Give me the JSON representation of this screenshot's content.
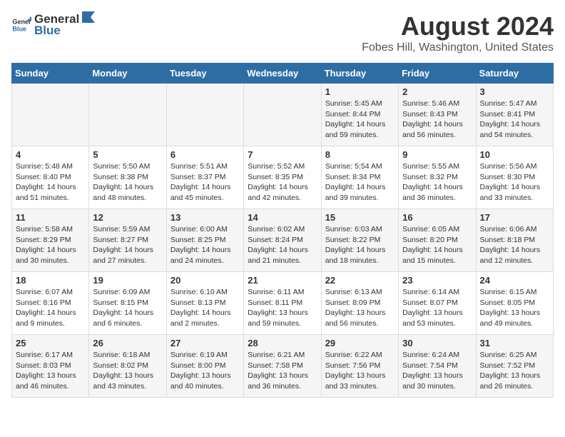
{
  "header": {
    "logo_general": "General",
    "logo_blue": "Blue",
    "title": "August 2024",
    "subtitle": "Fobes Hill, Washington, United States"
  },
  "weekdays": [
    "Sunday",
    "Monday",
    "Tuesday",
    "Wednesday",
    "Thursday",
    "Friday",
    "Saturday"
  ],
  "weeks": [
    [
      {
        "day": "",
        "info": ""
      },
      {
        "day": "",
        "info": ""
      },
      {
        "day": "",
        "info": ""
      },
      {
        "day": "",
        "info": ""
      },
      {
        "day": "1",
        "info": "Sunrise: 5:45 AM\nSunset: 8:44 PM\nDaylight: 14 hours\nand 59 minutes."
      },
      {
        "day": "2",
        "info": "Sunrise: 5:46 AM\nSunset: 8:43 PM\nDaylight: 14 hours\nand 56 minutes."
      },
      {
        "day": "3",
        "info": "Sunrise: 5:47 AM\nSunset: 8:41 PM\nDaylight: 14 hours\nand 54 minutes."
      }
    ],
    [
      {
        "day": "4",
        "info": "Sunrise: 5:48 AM\nSunset: 8:40 PM\nDaylight: 14 hours\nand 51 minutes."
      },
      {
        "day": "5",
        "info": "Sunrise: 5:50 AM\nSunset: 8:38 PM\nDaylight: 14 hours\nand 48 minutes."
      },
      {
        "day": "6",
        "info": "Sunrise: 5:51 AM\nSunset: 8:37 PM\nDaylight: 14 hours\nand 45 minutes."
      },
      {
        "day": "7",
        "info": "Sunrise: 5:52 AM\nSunset: 8:35 PM\nDaylight: 14 hours\nand 42 minutes."
      },
      {
        "day": "8",
        "info": "Sunrise: 5:54 AM\nSunset: 8:34 PM\nDaylight: 14 hours\nand 39 minutes."
      },
      {
        "day": "9",
        "info": "Sunrise: 5:55 AM\nSunset: 8:32 PM\nDaylight: 14 hours\nand 36 minutes."
      },
      {
        "day": "10",
        "info": "Sunrise: 5:56 AM\nSunset: 8:30 PM\nDaylight: 14 hours\nand 33 minutes."
      }
    ],
    [
      {
        "day": "11",
        "info": "Sunrise: 5:58 AM\nSunset: 8:29 PM\nDaylight: 14 hours\nand 30 minutes."
      },
      {
        "day": "12",
        "info": "Sunrise: 5:59 AM\nSunset: 8:27 PM\nDaylight: 14 hours\nand 27 minutes."
      },
      {
        "day": "13",
        "info": "Sunrise: 6:00 AM\nSunset: 8:25 PM\nDaylight: 14 hours\nand 24 minutes."
      },
      {
        "day": "14",
        "info": "Sunrise: 6:02 AM\nSunset: 8:24 PM\nDaylight: 14 hours\nand 21 minutes."
      },
      {
        "day": "15",
        "info": "Sunrise: 6:03 AM\nSunset: 8:22 PM\nDaylight: 14 hours\nand 18 minutes."
      },
      {
        "day": "16",
        "info": "Sunrise: 6:05 AM\nSunset: 8:20 PM\nDaylight: 14 hours\nand 15 minutes."
      },
      {
        "day": "17",
        "info": "Sunrise: 6:06 AM\nSunset: 8:18 PM\nDaylight: 14 hours\nand 12 minutes."
      }
    ],
    [
      {
        "day": "18",
        "info": "Sunrise: 6:07 AM\nSunset: 8:16 PM\nDaylight: 14 hours\nand 9 minutes."
      },
      {
        "day": "19",
        "info": "Sunrise: 6:09 AM\nSunset: 8:15 PM\nDaylight: 14 hours\nand 6 minutes."
      },
      {
        "day": "20",
        "info": "Sunrise: 6:10 AM\nSunset: 8:13 PM\nDaylight: 14 hours\nand 2 minutes."
      },
      {
        "day": "21",
        "info": "Sunrise: 6:11 AM\nSunset: 8:11 PM\nDaylight: 13 hours\nand 59 minutes."
      },
      {
        "day": "22",
        "info": "Sunrise: 6:13 AM\nSunset: 8:09 PM\nDaylight: 13 hours\nand 56 minutes."
      },
      {
        "day": "23",
        "info": "Sunrise: 6:14 AM\nSunset: 8:07 PM\nDaylight: 13 hours\nand 53 minutes."
      },
      {
        "day": "24",
        "info": "Sunrise: 6:15 AM\nSunset: 8:05 PM\nDaylight: 13 hours\nand 49 minutes."
      }
    ],
    [
      {
        "day": "25",
        "info": "Sunrise: 6:17 AM\nSunset: 8:03 PM\nDaylight: 13 hours\nand 46 minutes."
      },
      {
        "day": "26",
        "info": "Sunrise: 6:18 AM\nSunset: 8:02 PM\nDaylight: 13 hours\nand 43 minutes."
      },
      {
        "day": "27",
        "info": "Sunrise: 6:19 AM\nSunset: 8:00 PM\nDaylight: 13 hours\nand 40 minutes."
      },
      {
        "day": "28",
        "info": "Sunrise: 6:21 AM\nSunset: 7:58 PM\nDaylight: 13 hours\nand 36 minutes."
      },
      {
        "day": "29",
        "info": "Sunrise: 6:22 AM\nSunset: 7:56 PM\nDaylight: 13 hours\nand 33 minutes."
      },
      {
        "day": "30",
        "info": "Sunrise: 6:24 AM\nSunset: 7:54 PM\nDaylight: 13 hours\nand 30 minutes."
      },
      {
        "day": "31",
        "info": "Sunrise: 6:25 AM\nSunset: 7:52 PM\nDaylight: 13 hours\nand 26 minutes."
      }
    ]
  ]
}
